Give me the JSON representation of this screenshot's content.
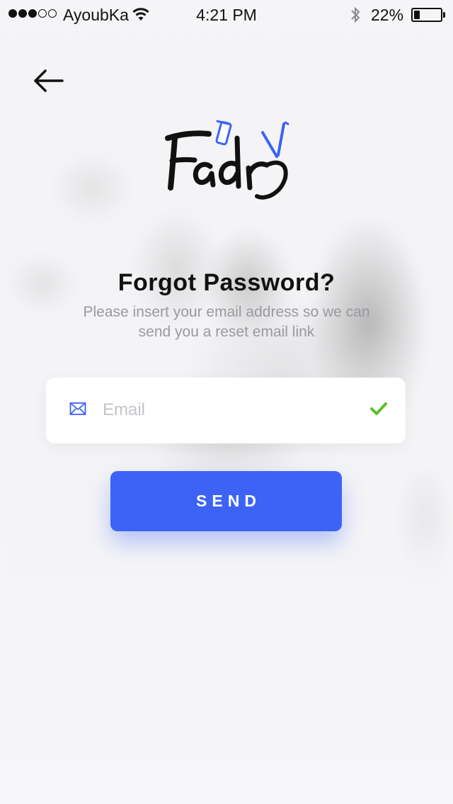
{
  "status_bar": {
    "carrier": "AyoubKa",
    "time": "4:21 PM",
    "battery_percent": "22%",
    "signal_bars_filled": 3,
    "signal_bars_total": 5,
    "battery_level": 0.22
  },
  "nav": {
    "back_icon": "arrow-left-icon"
  },
  "logo": {
    "text": "Fadr",
    "icons": [
      "clipper-icon",
      "razor-icon"
    ],
    "accent_color": "#3d63f6"
  },
  "header": {
    "title": "Forgot Password?",
    "subtitle_line1": "Please insert your email address so we can",
    "subtitle_line2": "send you a reset email link"
  },
  "form": {
    "email": {
      "placeholder": "Email",
      "value": "",
      "icon": "mail-icon",
      "valid_icon": "checkmark-icon",
      "valid_color": "#5bbf2a"
    },
    "send_label": "SEND",
    "button_color": "#3d63f6"
  }
}
